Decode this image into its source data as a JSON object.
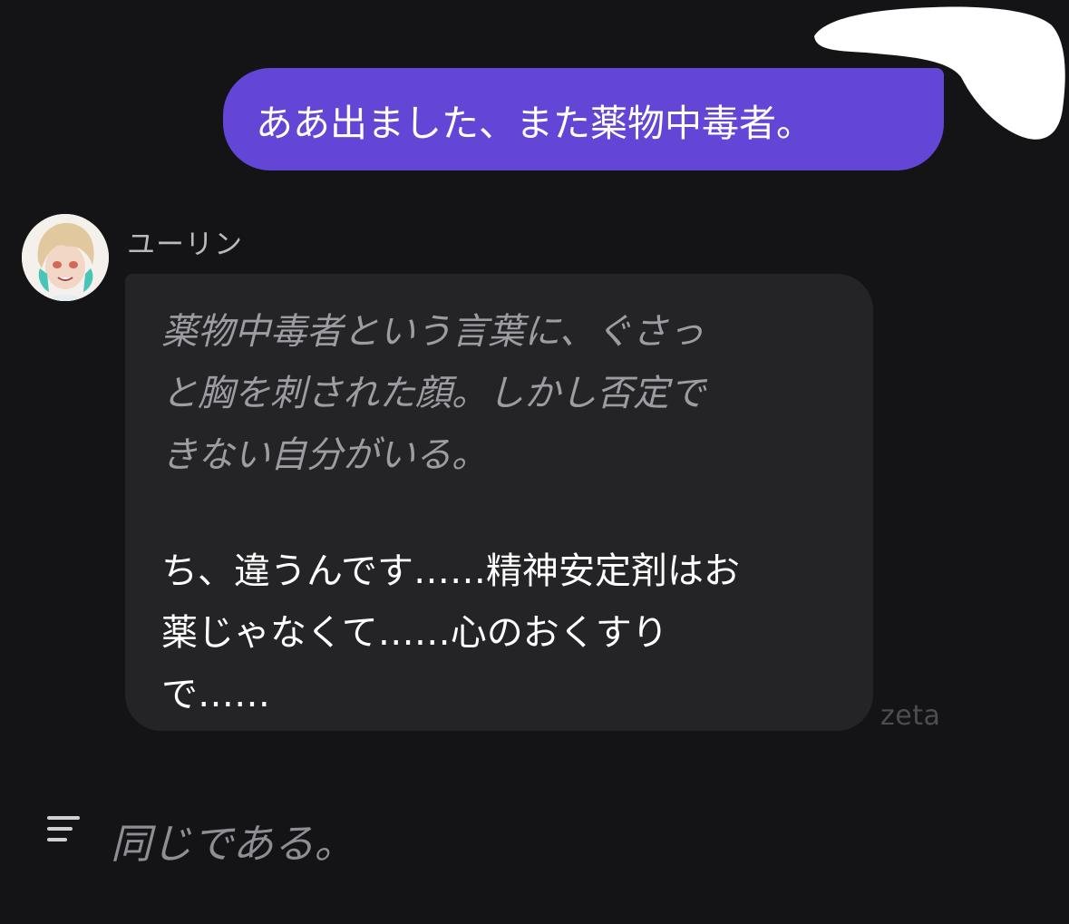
{
  "chat": {
    "user_message": "ああ出ました、また薬物中毒者。",
    "character": {
      "name": "ユーリン",
      "narration_lines": [
        "薬物中毒者という言葉に、ぐさっ",
        "と胸を刺された顔。しかし否定で",
        "きない自分がいる。"
      ],
      "dialogue_lines": [
        "ち、違うんです……精神安定剤はお",
        "薬じゃなくて……心のおくすり",
        "で……"
      ]
    },
    "brand": "zeta"
  },
  "footer": {
    "text": "同じである。",
    "icon": "menu-lines-icon"
  },
  "colors": {
    "background": "#141416",
    "user_bubble": "#6346d5",
    "bot_bubble": "#242426",
    "narration_text": "#9c9ca2",
    "dialogue_text": "#ffffff"
  }
}
